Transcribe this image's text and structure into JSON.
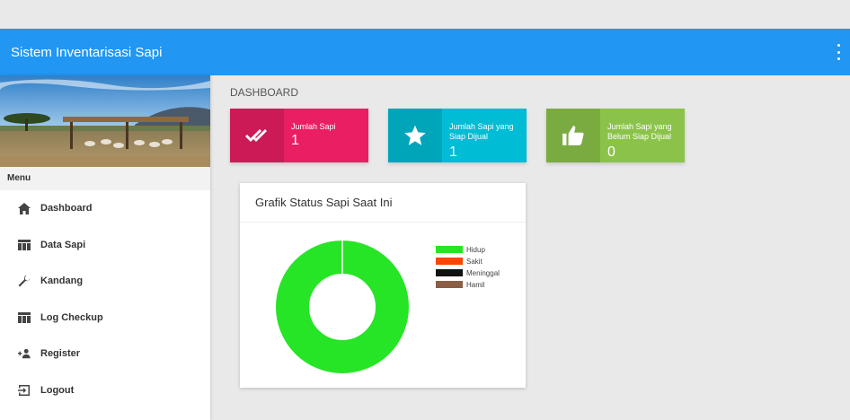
{
  "app": {
    "title": "Sistem Inventarisasi Sapi"
  },
  "sidebar": {
    "menu_header": "Menu",
    "items": [
      {
        "label": "Dashboard",
        "icon": "home-icon"
      },
      {
        "label": "Data Sapi",
        "icon": "table-icon"
      },
      {
        "label": "Kandang",
        "icon": "wrench-icon"
      },
      {
        "label": "Log Checkup",
        "icon": "table-icon"
      },
      {
        "label": "Register",
        "icon": "person-add-icon"
      },
      {
        "label": "Logout",
        "icon": "exit-icon"
      }
    ]
  },
  "main": {
    "breadcrumb": "DASHBOARD",
    "boxes": [
      {
        "label": "Jumlah Sapi",
        "value": "1",
        "color": "#e91e63",
        "icon": "double-check-icon"
      },
      {
        "label": "Jumlah Sapi yang Siap Dijual",
        "value": "1",
        "color": "#00bcd4",
        "icon": "star-icon"
      },
      {
        "label": "Jumlah Sapi yang Belum Siap Dijual",
        "value": "0",
        "color": "#8bc34a",
        "icon": "thumbs-up-icon"
      }
    ],
    "chart_card": {
      "title": "Grafik Status Sapi Saat Ini"
    }
  },
  "chart_data": {
    "type": "pie",
    "title": "Grafik Status Sapi Saat Ini",
    "categories": [
      "Hidup",
      "Sakit",
      "Meninggal",
      "Hamil"
    ],
    "values": [
      1,
      0,
      0,
      0
    ],
    "colors": [
      "#26e526",
      "#ff4500",
      "#111111",
      "#8b5e45"
    ],
    "legend_position": "right"
  }
}
